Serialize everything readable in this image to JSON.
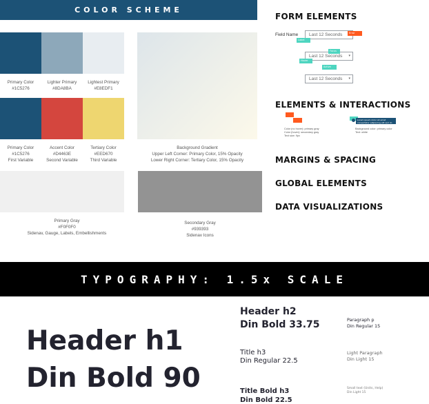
{
  "color_scheme": {
    "title": "COLOR SCHEME",
    "swatches": [
      {
        "name": "Primary Color",
        "hex": "#1C5276",
        "extra": ""
      },
      {
        "name": "Lighter Primary",
        "hex": "#8DA8BA",
        "extra": ""
      },
      {
        "name": "Lightest Primary",
        "hex": "#E8EDF1",
        "extra": ""
      },
      {
        "name": "Primary Color",
        "hex": "#1C5276",
        "extra": "First Variable"
      },
      {
        "name": "Accent Color",
        "hex": "#D4463E",
        "extra": "Second Variable"
      },
      {
        "name": "Tertiary Color",
        "hex": "#EED670",
        "extra": "Third Variable"
      }
    ],
    "gradient": {
      "name": "Background Gradient",
      "line1": "Upper Left Corner: Primary Color, 15% Opacity",
      "line2": "Lower Right Corner: Tertiary Color, 15% Opacity"
    },
    "primary_gray": {
      "name": "Primary Gray",
      "hex": "#F0F0F0",
      "extra": "Sidenav, Gauge, Labels, Embellishments"
    },
    "secondary_gray": {
      "name": "Secondary Gray",
      "hex": "#939393",
      "extra": "Sidenav Icons"
    }
  },
  "form_elements": {
    "title": "FORM ELEMENTS",
    "field_label": "Field Name",
    "select_value": "Last 12 Seconds",
    "tags": {
      "label": "Label",
      "error": "Error",
      "focus": "Focus",
      "hover": "Hover",
      "active": "Active",
      "disabled": "Disabled"
    }
  },
  "elements_interactions": {
    "title": "ELEMENTS & INTERACTIONS",
    "left_caption": [
      "Color (no hover): primary gray",
      "Color (hover): secondary gray",
      "Text size: 9px"
    ],
    "right_caption": [
      "Background color: primary color",
      "Text: white"
    ],
    "tooltip_text": "Lorem ipsum dolor sit amet consectetur adipiscing elit sed do"
  },
  "sections": [
    "MARGINS & SPACING",
    "GLOBAL ELEMENTS",
    "DATA VISUALIZATIONS"
  ],
  "typography": {
    "title": "TYPOGRAPHY: 1.5x SCALE",
    "h1": {
      "line1": "Header h1",
      "line2": "Din Bold 90"
    },
    "h2": {
      "line1": "Header h2",
      "line2": "Din Bold 33.75"
    },
    "h3": {
      "line1": "Title h3",
      "line2": "Din Regular 22.5"
    },
    "h3b": {
      "line1": "Title Bold h3",
      "line2": "Din Bold 22.5"
    },
    "p": {
      "line1": "Paragraph p",
      "line2": "Din Regular 15"
    },
    "lp": {
      "line1": "Light Paragraph",
      "line2": "Din Light 15"
    },
    "st": {
      "line1": "Small text (Units, Help)",
      "line2": "Din Light 15"
    }
  }
}
